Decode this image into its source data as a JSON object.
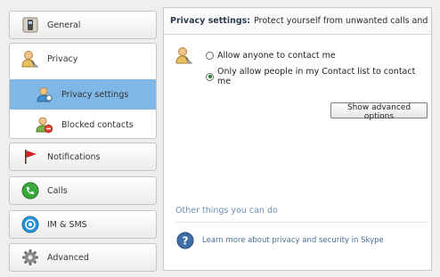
{
  "sidebar": {
    "general": {
      "label": "General",
      "icon": "phone-handset-icon"
    },
    "privacy": {
      "label": "Privacy",
      "icon": "privacy-user-icon",
      "items": [
        {
          "label": "Privacy settings",
          "icon": "privacy-settings-user-icon",
          "selected": true
        },
        {
          "label": "Blocked contacts",
          "icon": "blocked-contacts-icon",
          "selected": false
        }
      ]
    },
    "notifications": {
      "label": "Notifications",
      "icon": "red-flag-icon"
    },
    "calls": {
      "label": "Calls",
      "icon": "green-phone-icon"
    },
    "im_sms": {
      "label": "IM & SMS",
      "icon": "chat-bubble-icon"
    },
    "advanced": {
      "label": "Advanced",
      "icon": "gear-icon"
    }
  },
  "main": {
    "header_title": "Privacy settings:",
    "header_subtitle": "Protect yourself from unwanted calls and IMs",
    "radio_options": [
      {
        "label": "Allow anyone to contact me",
        "checked": false
      },
      {
        "label": "Only allow people in my Contact list to contact me",
        "checked": true
      }
    ],
    "advanced_button": "Show advanced options",
    "other_title": "Other things you can do",
    "learn_more": "Learn more about privacy and security in Skype"
  },
  "colors": {
    "selected_item": "#7fb8e6",
    "link_text": "#4a6f96",
    "section_title": "#6a8fb5"
  }
}
